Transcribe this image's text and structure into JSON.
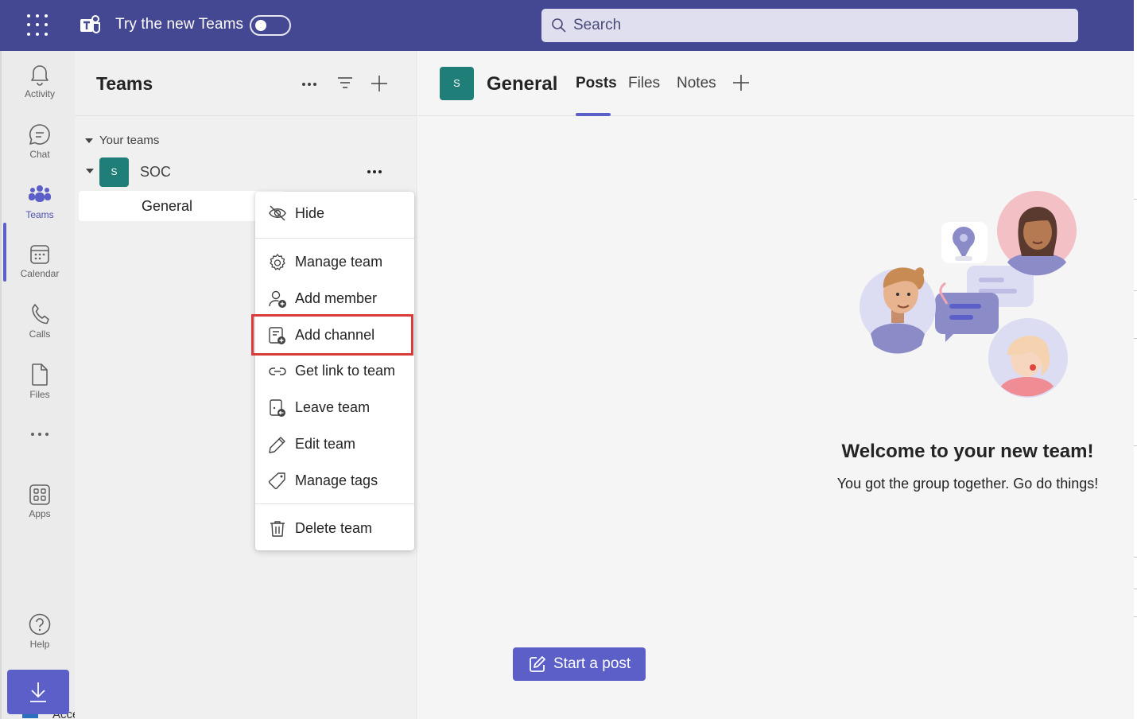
{
  "titlebar": {
    "try_new_label": "Try the new Teams",
    "toggle_state": "off",
    "search_placeholder": "Search",
    "bar_color": "#444791"
  },
  "rail": {
    "items": [
      {
        "label": "Activity",
        "icon": "bell-icon"
      },
      {
        "label": "Chat",
        "icon": "chat-icon"
      },
      {
        "label": "Teams",
        "icon": "teams-icon",
        "active": true
      },
      {
        "label": "Calendar",
        "icon": "calendar-icon"
      },
      {
        "label": "Calls",
        "icon": "phone-icon"
      },
      {
        "label": "Files",
        "icon": "file-icon"
      },
      {
        "label": "",
        "icon": "more-icon"
      },
      {
        "label": "Apps",
        "icon": "apps-icon"
      },
      {
        "label": "Help",
        "icon": "help-icon"
      }
    ],
    "download_icon": "download-icon",
    "behind_text": "Access keys"
  },
  "panel": {
    "title": "Teams",
    "section_label": "Your teams",
    "team": {
      "avatar_letter": "S",
      "name": "SOC"
    },
    "channel": {
      "name": "General"
    }
  },
  "menu": {
    "items": [
      {
        "label": "Hide",
        "icon": "eye-off-icon"
      },
      {
        "label": "Manage team",
        "icon": "gear-icon"
      },
      {
        "label": "Add member",
        "icon": "add-person-icon"
      },
      {
        "label": "Add channel",
        "icon": "add-channel-icon",
        "highlighted": true
      },
      {
        "label": "Get link to team",
        "icon": "link-icon"
      },
      {
        "label": "Leave team",
        "icon": "leave-icon"
      },
      {
        "label": "Edit team",
        "icon": "pencil-icon"
      },
      {
        "label": "Manage tags",
        "icon": "tag-icon"
      },
      {
        "label": "Delete team",
        "icon": "trash-icon"
      }
    ],
    "highlight_color": "#d83b3b"
  },
  "main": {
    "avatar_letter": "S",
    "title": "General",
    "tabs": [
      {
        "label": "Posts",
        "active": true
      },
      {
        "label": "Files"
      },
      {
        "label": "Notes"
      }
    ],
    "welcome_title": "Welcome to your new team!",
    "welcome_subtitle": "You got the group together. Go do things!",
    "start_post_label": "Start a post",
    "accent": "#5b5fc7"
  }
}
